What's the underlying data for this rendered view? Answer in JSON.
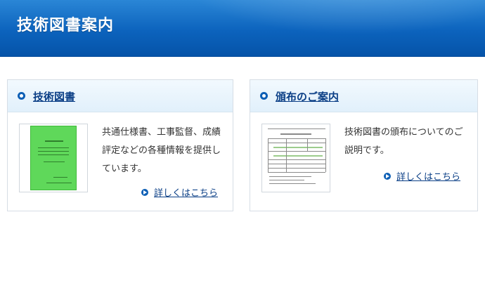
{
  "header": {
    "title": "技術図書案内"
  },
  "cards": [
    {
      "title": "技術図書",
      "description": "共通仕様書、工事監督、成績評定などの各種情報を提供しています。",
      "link_label": "詳しくはこちら",
      "thumbnail_icon": "green-book-cover-icon"
    },
    {
      "title": "頒布のご案内",
      "description": "技術図書の頒布についてのご説明です。",
      "link_label": "詳しくはこちら",
      "thumbnail_icon": "order-form-document-icon"
    }
  ],
  "colors": {
    "header_blue": "#0c63bd",
    "link_blue": "#0b3f86",
    "card_header_bg": "#e1f0fb",
    "book_green": "#5fd85a"
  }
}
